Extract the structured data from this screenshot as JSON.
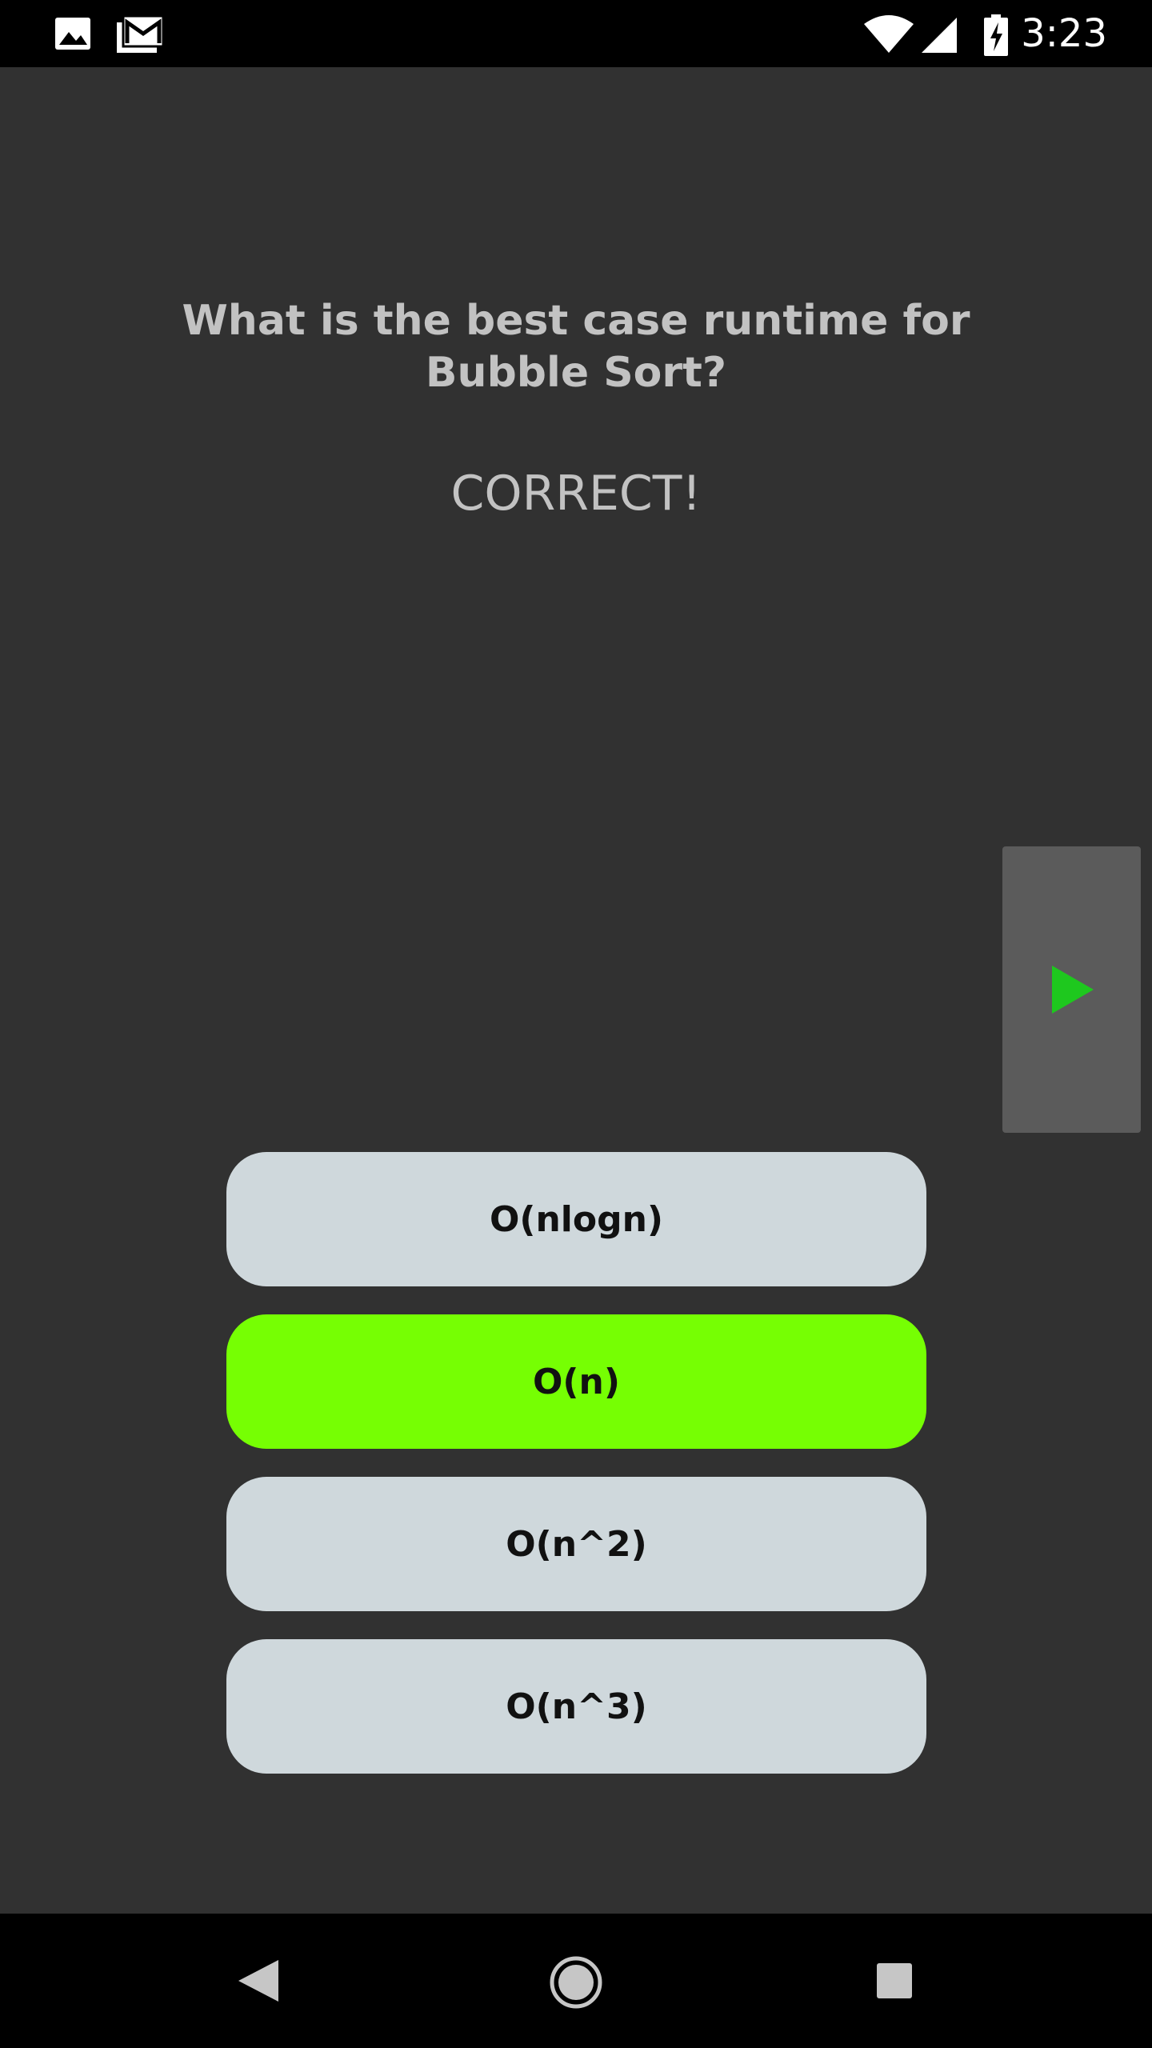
{
  "status_bar": {
    "time": "3:23",
    "icons": [
      "image-notification-icon",
      "gmail-notification-icon",
      "wifi-icon",
      "cell-signal-icon",
      "battery-charging-icon"
    ]
  },
  "quiz": {
    "question": "What is the best case runtime for Bubble Sort?",
    "feedback": "CORRECT!",
    "answers": [
      {
        "label": "O(nlogn)",
        "state": "default"
      },
      {
        "label": "O(n)",
        "state": "correct"
      },
      {
        "label": "O(n^2)",
        "state": "default"
      },
      {
        "label": "O(n^3)",
        "state": "default"
      }
    ],
    "next_icon": "play-arrow-icon"
  },
  "colors": {
    "background": "#313131",
    "answer_default": "#cfd8dc",
    "answer_correct": "#76ff03",
    "next_button_bg": "#5b5b5b",
    "next_arrow": "#1ec81e",
    "text_muted": "#c2c2c2"
  },
  "nav_bar": {
    "icons": [
      "back-icon",
      "home-icon",
      "recents-icon"
    ]
  }
}
